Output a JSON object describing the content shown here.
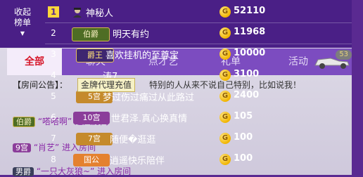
{
  "rank_label": {
    "line1": "收起",
    "line2": "榜单",
    "arrow": "▼"
  },
  "tabs": [
    "全部",
    "聊天",
    "点才艺",
    "礼单",
    "活动"
  ],
  "car_count": "53",
  "notice": {
    "label": "【房间公告】：",
    "body": "特别的人从来不说自己特别，比如说我！"
  },
  "tooltip": "金牌代理充值",
  "rows": [
    {
      "num": "1",
      "badge": "",
      "name": "神秘人",
      "value": "52110"
    },
    {
      "num": "2",
      "badge": "伯爵",
      "name": "明天有约",
      "value": "11968"
    },
    {
      "num": "3",
      "badge": "爵王",
      "name": "喜欢挂机的至尊宝",
      "value": "10000"
    },
    {
      "num": "4",
      "badge": "",
      "name": "涛7",
      "value": "3100"
    },
    {
      "num": "5",
      "badge": "5宫",
      "name": "梦过伤过痛过从此路过",
      "value": "2400"
    },
    {
      "num": "6",
      "badge": "10宫",
      "name": "世君泽.真心换真情",
      "value": "105"
    },
    {
      "num": "7",
      "badge": "7宫",
      "name": "随便�逛逛",
      "value": "100"
    },
    {
      "num": "8",
      "badge": "国公",
      "name": "逍遥快乐陪伴",
      "value": "100"
    }
  ],
  "chat": [
    {
      "badge": "伯爵",
      "text": "“嗒嗒啊” 进入房间"
    },
    {
      "badge": "9宫",
      "text": "“肖艺” 进入房间"
    },
    {
      "badge": "男爵",
      "text": "“一只大灰狼~” 进入房间"
    }
  ],
  "colors": {
    "panel": "#4a1f86",
    "accent": "#d6172a",
    "coin": "#f0b400"
  }
}
